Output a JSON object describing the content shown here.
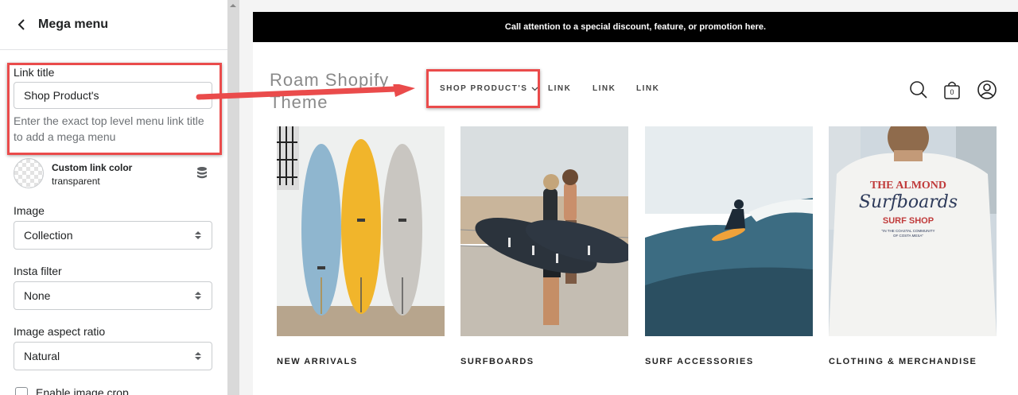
{
  "panel": {
    "title": "Mega menu",
    "link_title_label": "Link title",
    "link_title_value": "Shop Product's",
    "link_title_help": "Enter the exact top level menu link title to add a mega menu",
    "color_name": "Custom link color",
    "color_value": "transparent",
    "image_label": "Image",
    "image_value": "Collection",
    "insta_label": "Insta filter",
    "insta_value": "None",
    "aspect_label": "Image aspect ratio",
    "aspect_value": "Natural",
    "crop_label": "Enable image crop"
  },
  "preview": {
    "announcement": "Call attention to a special discount, feature, or promotion here.",
    "logo": "Roam Shopify Theme",
    "nav": [
      "SHOP PRODUCT'S",
      "LINK",
      "LINK",
      "LINK"
    ],
    "cart_count": "0",
    "cards": [
      "NEW ARRIVALS",
      "SURFBOARDS",
      "SURF ACCESSORIES",
      "CLOTHING & MERCHANDISE"
    ],
    "shirt_text": {
      "line1": "THE ALMOND",
      "line2": "Surfboards",
      "line3": "SURF SHOP",
      "line4": "\"IN THE COASTAL COMMUNITY",
      "line5": "OF COSTA MESA\""
    }
  },
  "colors": {
    "highlight": "#ea4b4b",
    "announcement_bg": "#000000"
  }
}
